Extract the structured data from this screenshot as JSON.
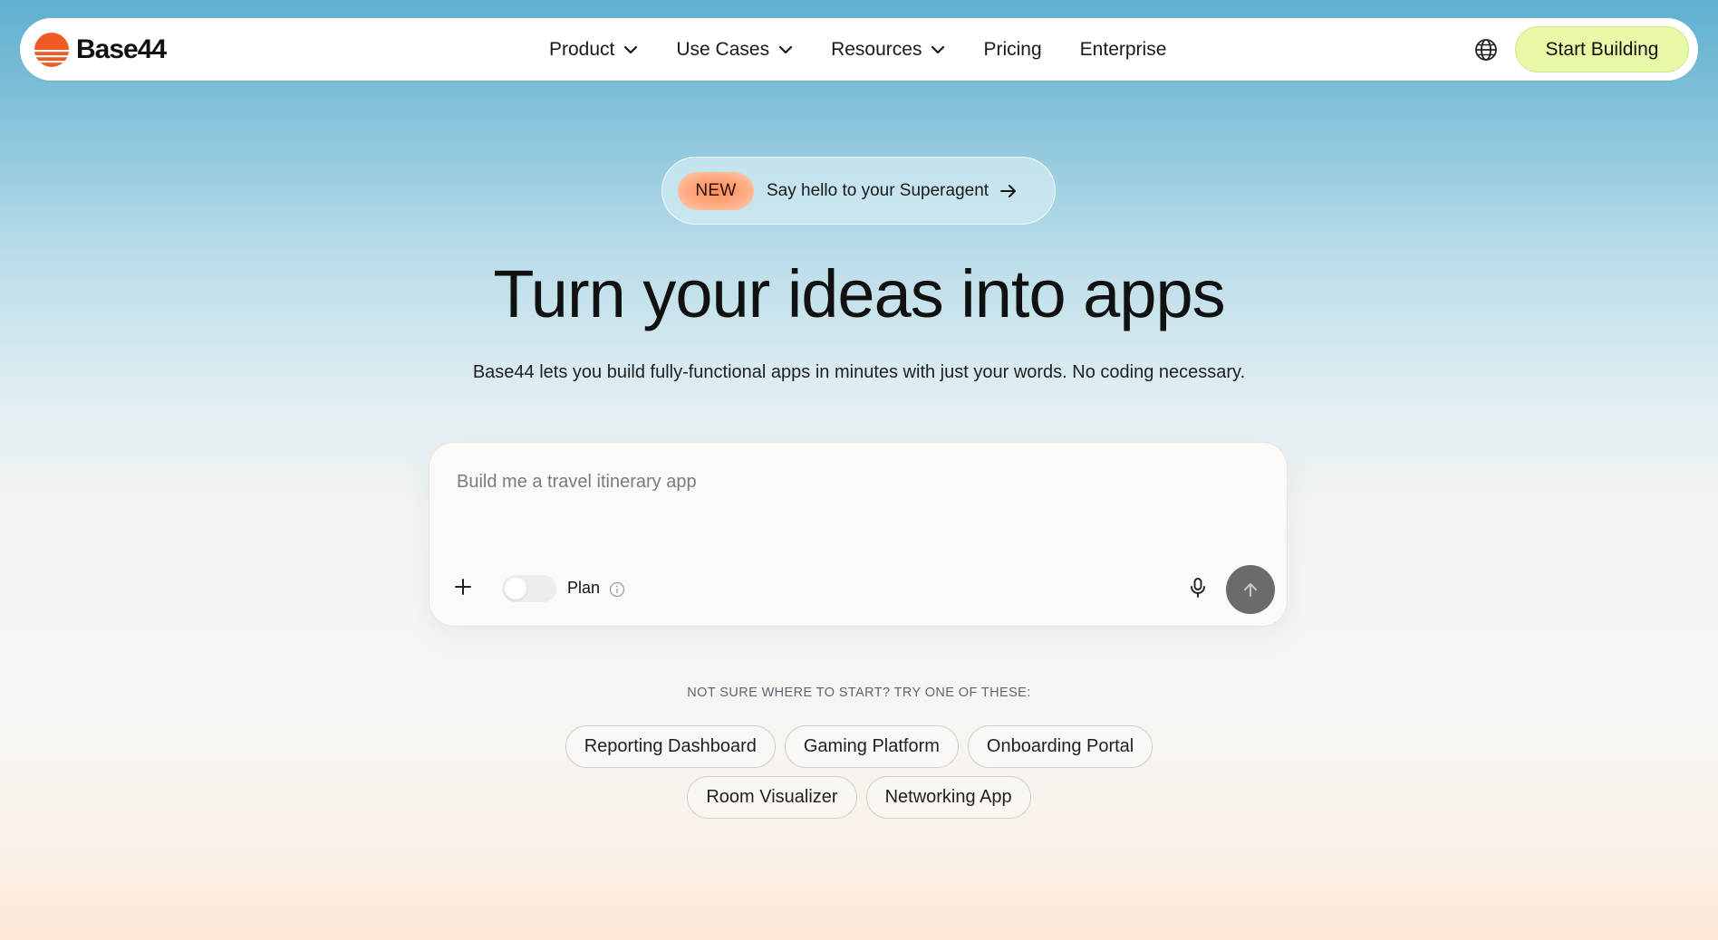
{
  "nav": {
    "logo_text": "Base44",
    "items": [
      {
        "label": "Product",
        "has_dropdown": true
      },
      {
        "label": "Use Cases",
        "has_dropdown": true
      },
      {
        "label": "Resources",
        "has_dropdown": true
      },
      {
        "label": "Pricing",
        "has_dropdown": false
      },
      {
        "label": "Enterprise",
        "has_dropdown": false
      }
    ],
    "language_icon": "globe-icon",
    "cta_label": "Start Building"
  },
  "announcement": {
    "badge": "NEW",
    "text": "Say hello to your Superagent"
  },
  "hero": {
    "title": "Turn your ideas into apps",
    "subtitle": "Base44 lets you build fully-functional apps in minutes with just your words. No coding necessary."
  },
  "prompt": {
    "placeholder": "Build me a travel itinerary app",
    "value": "",
    "plan_label": "Plan",
    "plan_enabled": false
  },
  "suggestions": {
    "heading": "NOT SURE WHERE TO START? TRY ONE OF THESE:",
    "row1": [
      "Reporting Dashboard",
      "Gaming Platform",
      "Onboarding Portal"
    ],
    "row2": [
      "Room Visualizer",
      "Networking App"
    ]
  },
  "colors": {
    "brand_orange": "#f15a22",
    "cta_bg": "#e7f8a6",
    "send_bg": "#6b6b6b"
  }
}
